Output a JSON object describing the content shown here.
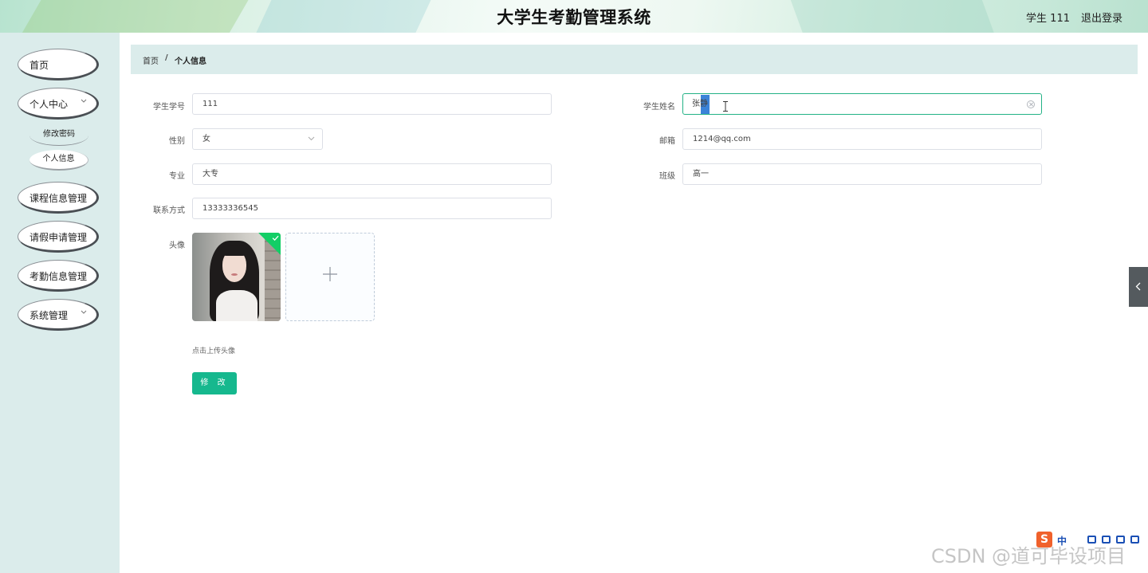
{
  "header": {
    "app_title": "大学生考勤管理系统",
    "user_label": "学生 111",
    "logout_label": "退出登录"
  },
  "sidebar": {
    "items": [
      {
        "label": "首页",
        "has_submenu": false
      },
      {
        "label": "个人中心",
        "has_submenu": true,
        "expanded": true,
        "children": [
          {
            "label": "修改密码"
          },
          {
            "label": "个人信息"
          }
        ]
      },
      {
        "label": "课程信息管理",
        "has_submenu": false
      },
      {
        "label": "请假申请管理",
        "has_submenu": false
      },
      {
        "label": "考勤信息管理",
        "has_submenu": false
      },
      {
        "label": "系统管理",
        "has_submenu": true,
        "expanded": false
      }
    ]
  },
  "breadcrumb": {
    "home": "首页",
    "separator": "/",
    "current": "个人信息"
  },
  "form": {
    "student_id": {
      "label": "学生学号",
      "value": "111"
    },
    "student_name": {
      "label": "学生姓名",
      "value": "张静"
    },
    "gender": {
      "label": "性别",
      "value": "女"
    },
    "email": {
      "label": "邮箱",
      "value": "1214@qq.com"
    },
    "major": {
      "label": "专业",
      "value": "大专"
    },
    "class": {
      "label": "班级",
      "value": "高一"
    },
    "phone": {
      "label": "联系方式",
      "value": "13333336545"
    },
    "avatar": {
      "label": "头像",
      "upload_tip": "点击上传头像"
    },
    "submit_label": "修 改"
  },
  "ime": {
    "logo": "S",
    "mode": "中"
  },
  "watermark": "CSDN @道可毕设项目",
  "colors": {
    "accent": "#16b88e",
    "sidebar_bg": "#dbeceb",
    "selection": "#3b83d8",
    "success": "#13ce66"
  }
}
